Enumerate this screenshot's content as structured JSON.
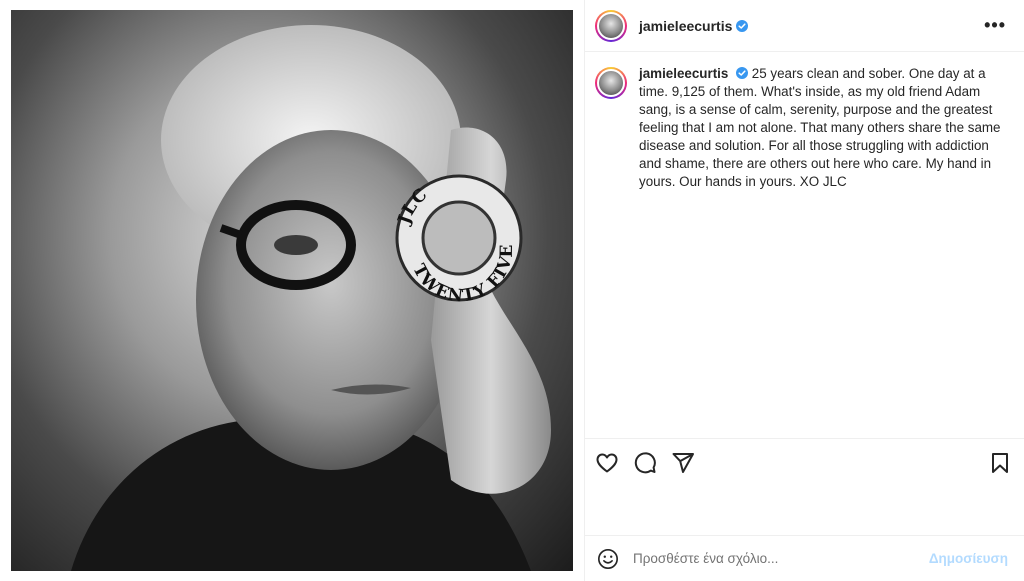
{
  "post": {
    "username": "jamieleecurtis",
    "image_alt": "Black and white portrait holding a ring",
    "coin": {
      "top_text": "JLC",
      "bottom_text": "TWENTY FIVE"
    }
  },
  "header": {
    "username": "jamieleecurtis",
    "more_label": "•••"
  },
  "caption": {
    "username": "jamieleecurtis",
    "text": "25 years clean and sober. One day at a time. 9,125 of them. What's inside, as my old friend Adam sang, is a sense of calm, serenity, purpose and the greatest feeling that I am not alone. That many others share the same disease and solution. For all those struggling with addiction and shame, there are others out here who care. My hand in yours. Our hands in yours. XO JLC"
  },
  "actions": {
    "like": "heart-icon",
    "comment": "comment-icon",
    "share": "share-icon",
    "save": "bookmark-icon"
  },
  "comment": {
    "placeholder": "Προσθέστε ένα σχόλιο...",
    "post_label": "Δημοσίευση"
  },
  "colors": {
    "verified": "#3897f0",
    "post_button_disabled": "#b3dbff",
    "border": "#efefef"
  }
}
